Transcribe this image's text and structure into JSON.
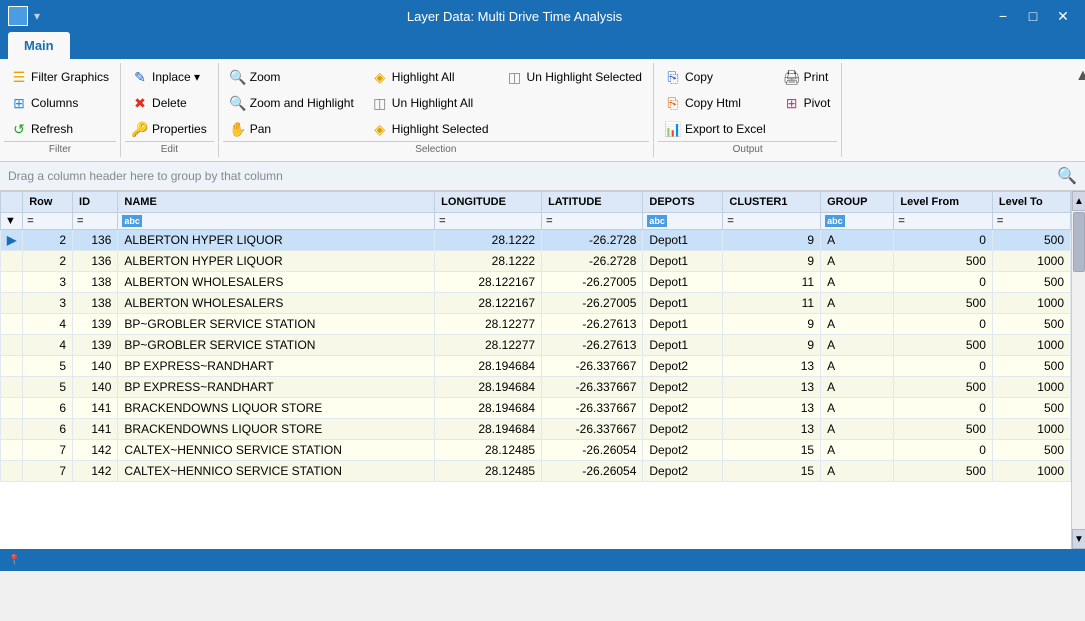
{
  "titlebar": {
    "title": "Layer Data: Multi Drive Time Analysis",
    "minimize": "−",
    "maximize": "□",
    "close": "✕"
  },
  "tabs": [
    {
      "id": "main",
      "label": "Main",
      "active": true
    }
  ],
  "ribbon": {
    "filter_group": {
      "label": "Filter",
      "buttons": [
        {
          "id": "filter-graphics",
          "label": "Filter Graphics",
          "icon": "☰",
          "iconColor": "icon-filter"
        },
        {
          "id": "columns",
          "label": "Columns",
          "icon": "⊞",
          "iconColor": "icon-columns"
        },
        {
          "id": "refresh",
          "label": "Refresh",
          "icon": "↺",
          "iconColor": "icon-refresh"
        }
      ]
    },
    "edit_group": {
      "label": "Edit",
      "buttons": [
        {
          "id": "inplace",
          "label": "Inplace ▾",
          "icon": "✎",
          "iconColor": "icon-inplace"
        },
        {
          "id": "delete",
          "label": "Delete",
          "icon": "✖",
          "iconColor": "icon-delete"
        },
        {
          "id": "properties",
          "label": "Properties",
          "icon": "🔑",
          "iconColor": "icon-props"
        }
      ]
    },
    "selection_group": {
      "label": "Selection",
      "buttons_col1": [
        {
          "id": "zoom",
          "label": "Zoom",
          "icon": "🔍",
          "iconColor": "icon-zoom"
        },
        {
          "id": "zoom-highlight",
          "label": "Zoom and Highlight",
          "icon": "🔍",
          "iconColor": "icon-zoom2"
        },
        {
          "id": "pan",
          "label": "Pan",
          "icon": "✋",
          "iconColor": "icon-pan"
        }
      ],
      "buttons_col2": [
        {
          "id": "highlight-all",
          "label": "Highlight All",
          "icon": "◈",
          "iconColor": "icon-highlight"
        },
        {
          "id": "unhighlight-all",
          "label": "Un Highlight All",
          "icon": "◫",
          "iconColor": "icon-unhighlight"
        },
        {
          "id": "highlight-selected",
          "label": "Highlight Selected",
          "icon": "◈",
          "iconColor": "icon-highlight"
        }
      ],
      "buttons_col3": [
        {
          "id": "unhighlight-selected",
          "label": "Un Highlight Selected",
          "icon": "◫",
          "iconColor": "icon-unhighlight"
        }
      ]
    },
    "output_group": {
      "label": "Output",
      "buttons_col1": [
        {
          "id": "copy",
          "label": "Copy",
          "icon": "⎘",
          "iconColor": "icon-copy"
        },
        {
          "id": "copy-html",
          "label": "Copy Html",
          "icon": "⎘",
          "iconColor": "icon-html"
        },
        {
          "id": "export-excel",
          "label": "Export to Excel",
          "icon": "📊",
          "iconColor": "icon-excel"
        }
      ],
      "buttons_col2": [
        {
          "id": "print",
          "label": "Print",
          "icon": "🖨",
          "iconColor": "icon-print"
        },
        {
          "id": "pivot",
          "label": "Pivot",
          "icon": "⊞",
          "iconColor": "icon-pivot"
        }
      ]
    }
  },
  "dragbar": {
    "text": "Drag a column header here to group by that column"
  },
  "table": {
    "columns": [
      "Row",
      "ID",
      "NAME",
      "LONGITUDE",
      "LATITUDE",
      "DEPOTS",
      "CLUSTER1",
      "GROUP",
      "Level From",
      "Level To"
    ],
    "filter_row": [
      "▼",
      "=",
      "=",
      "abc",
      "=",
      "=",
      "abc",
      "=",
      "abc",
      "=",
      "="
    ],
    "rows": [
      {
        "row_marker": "▶",
        "Row": "2",
        "ID": "136",
        "NAME": "ALBERTON HYPER LIQUOR",
        "LONGITUDE": "28.1222",
        "LATITUDE": "-26.2728",
        "DEPOTS": "Depot1",
        "CLUSTER1": "9",
        "GROUP": "A",
        "LevelFrom": "0",
        "LevelTo": "500",
        "highlight": "blue"
      },
      {
        "row_marker": "",
        "Row": "2",
        "ID": "136",
        "NAME": "ALBERTON HYPER LIQUOR",
        "LONGITUDE": "28.1222",
        "LATITUDE": "-26.2728",
        "DEPOTS": "Depot1",
        "CLUSTER1": "9",
        "GROUP": "A",
        "LevelFrom": "500",
        "LevelTo": "1000",
        "highlight": "none"
      },
      {
        "row_marker": "",
        "Row": "3",
        "ID": "138",
        "NAME": "ALBERTON WHOLESALERS",
        "LONGITUDE": "28.122167",
        "LATITUDE": "-26.27005",
        "DEPOTS": "Depot1",
        "CLUSTER1": "11",
        "GROUP": "A",
        "LevelFrom": "0",
        "LevelTo": "500",
        "highlight": "none"
      },
      {
        "row_marker": "",
        "Row": "3",
        "ID": "138",
        "NAME": "ALBERTON WHOLESALERS",
        "LONGITUDE": "28.122167",
        "LATITUDE": "-26.27005",
        "DEPOTS": "Depot1",
        "CLUSTER1": "11",
        "GROUP": "A",
        "LevelFrom": "500",
        "LevelTo": "1000",
        "highlight": "none"
      },
      {
        "row_marker": "",
        "Row": "4",
        "ID": "139",
        "NAME": "BP~GROBLER SERVICE STATION",
        "LONGITUDE": "28.12277",
        "LATITUDE": "-26.27613",
        "DEPOTS": "Depot1",
        "CLUSTER1": "9",
        "GROUP": "A",
        "LevelFrom": "0",
        "LevelTo": "500",
        "highlight": "none"
      },
      {
        "row_marker": "",
        "Row": "4",
        "ID": "139",
        "NAME": "BP~GROBLER SERVICE STATION",
        "LONGITUDE": "28.12277",
        "LATITUDE": "-26.27613",
        "DEPOTS": "Depot1",
        "CLUSTER1": "9",
        "GROUP": "A",
        "LevelFrom": "500",
        "LevelTo": "1000",
        "highlight": "none"
      },
      {
        "row_marker": "",
        "Row": "5",
        "ID": "140",
        "NAME": "BP EXPRESS~RANDHART",
        "LONGITUDE": "28.194684",
        "LATITUDE": "-26.337667",
        "DEPOTS": "Depot2",
        "CLUSTER1": "13",
        "GROUP": "A",
        "LevelFrom": "0",
        "LevelTo": "500",
        "highlight": "none"
      },
      {
        "row_marker": "",
        "Row": "5",
        "ID": "140",
        "NAME": "BP EXPRESS~RANDHART",
        "LONGITUDE": "28.194684",
        "LATITUDE": "-26.337667",
        "DEPOTS": "Depot2",
        "CLUSTER1": "13",
        "GROUP": "A",
        "LevelFrom": "500",
        "LevelTo": "1000",
        "highlight": "none"
      },
      {
        "row_marker": "",
        "Row": "6",
        "ID": "141",
        "NAME": "BRACKENDOWNS LIQUOR STORE",
        "LONGITUDE": "28.194684",
        "LATITUDE": "-26.337667",
        "DEPOTS": "Depot2",
        "CLUSTER1": "13",
        "GROUP": "A",
        "LevelFrom": "0",
        "LevelTo": "500",
        "highlight": "none"
      },
      {
        "row_marker": "",
        "Row": "6",
        "ID": "141",
        "NAME": "BRACKENDOWNS LIQUOR STORE",
        "LONGITUDE": "28.194684",
        "LATITUDE": "-26.337667",
        "DEPOTS": "Depot2",
        "CLUSTER1": "13",
        "GROUP": "A",
        "LevelFrom": "500",
        "LevelTo": "1000",
        "highlight": "none"
      },
      {
        "row_marker": "",
        "Row": "7",
        "ID": "142",
        "NAME": "CALTEX~HENNICO SERVICE STATION",
        "LONGITUDE": "28.12485",
        "LATITUDE": "-26.26054",
        "DEPOTS": "Depot2",
        "CLUSTER1": "15",
        "GROUP": "A",
        "LevelFrom": "0",
        "LevelTo": "500",
        "highlight": "none"
      },
      {
        "row_marker": "",
        "Row": "7",
        "ID": "142",
        "NAME": "CALTEX~HENNICO SERVICE STATION",
        "LONGITUDE": "28.12485",
        "LATITUDE": "-26.26054",
        "DEPOTS": "Depot2",
        "CLUSTER1": "15",
        "GROUP": "A",
        "LevelFrom": "500",
        "LevelTo": "1000",
        "highlight": "none"
      }
    ]
  },
  "statusbar": {
    "items": [
      "",
      "",
      "",
      "",
      "",
      "",
      "",
      ""
    ]
  }
}
